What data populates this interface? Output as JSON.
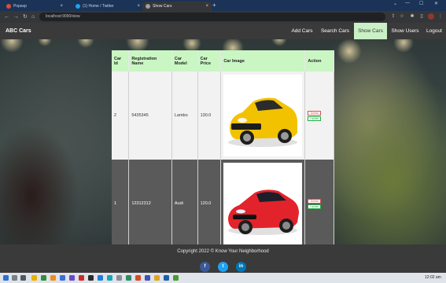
{
  "browser": {
    "tabs": [
      {
        "label": "Pnpavp",
        "active": false
      },
      {
        "label": "(1) Home / Twitter",
        "active": false
      },
      {
        "label": "Show Cars",
        "active": true
      }
    ],
    "new_tab": "+",
    "address": "localhost:9090/view"
  },
  "navbar": {
    "brand": "ABC Cars",
    "links": [
      "Add Cars",
      "Search Cars",
      "Show Cars",
      "Show Users",
      "Logout"
    ],
    "active": "Show Cars"
  },
  "table": {
    "headers": [
      "Car Id",
      "Registration Name",
      "Car Model",
      "Car Price",
      "Car Image",
      "Action"
    ],
    "rows": [
      {
        "id": "2",
        "reg": "5435345",
        "model": "Lambo",
        "price": "130.0",
        "color": "#f2c200"
      },
      {
        "id": "1",
        "reg": "12312312",
        "model": "Audi",
        "price": "120.0",
        "color": "#e3232b"
      }
    ],
    "delete_label": "Delete",
    "update_label": "Update"
  },
  "footer": {
    "copyright": "Copyright 2022 © Know Your Neighborhood",
    "social": [
      {
        "glyph": "f",
        "color": "#3b5998"
      },
      {
        "glyph": "t",
        "color": "#1da1f2"
      },
      {
        "glyph": "in",
        "color": "#0077b5"
      }
    ]
  },
  "taskbar": {
    "clock": "12:02 am"
  }
}
